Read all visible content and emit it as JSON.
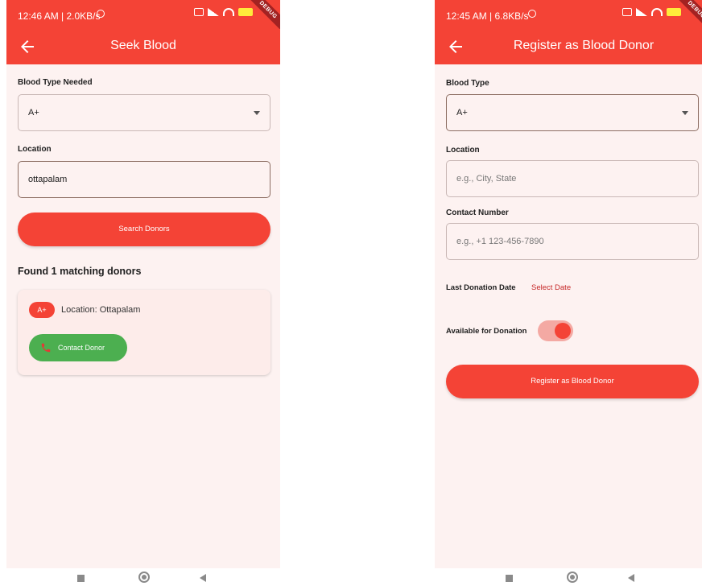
{
  "colors": {
    "primary": "#f44336",
    "success": "#4caf50",
    "background": "#fdf2f1",
    "toggle_track": "#f4a9a3"
  },
  "seek_screen": {
    "status_time": "12:46 AM | 2.0KB/s",
    "status_alarm_icon": "alarm-icon",
    "debug_label": "DEBUG",
    "title": "Seek Blood",
    "blood_type_label": "Blood Type Needed",
    "blood_type_value": "A+",
    "location_label": "Location",
    "location_value": "ottapalam",
    "search_button": "Search Donors",
    "results_heading": "Found 1 matching donors",
    "donors": [
      {
        "blood_type": "A+",
        "location": "Location: Ottapalam",
        "contact_button": "Contact Donor"
      }
    ]
  },
  "register_screen": {
    "status_time": "12:45 AM | 6.8KB/s",
    "debug_label": "DEBUG",
    "title": "Register as Blood Donor",
    "blood_type_label": "Blood Type",
    "blood_type_value": "A+",
    "location_label": "Location",
    "location_placeholder": "e.g., City, State",
    "contact_label": "Contact Number",
    "contact_placeholder": "e.g., +1 123-456-7890",
    "last_donation_label": "Last Donation Date",
    "select_date": "Select Date",
    "available_label": "Available for Donation",
    "available": true,
    "register_button": "Register as Blood Donor"
  }
}
